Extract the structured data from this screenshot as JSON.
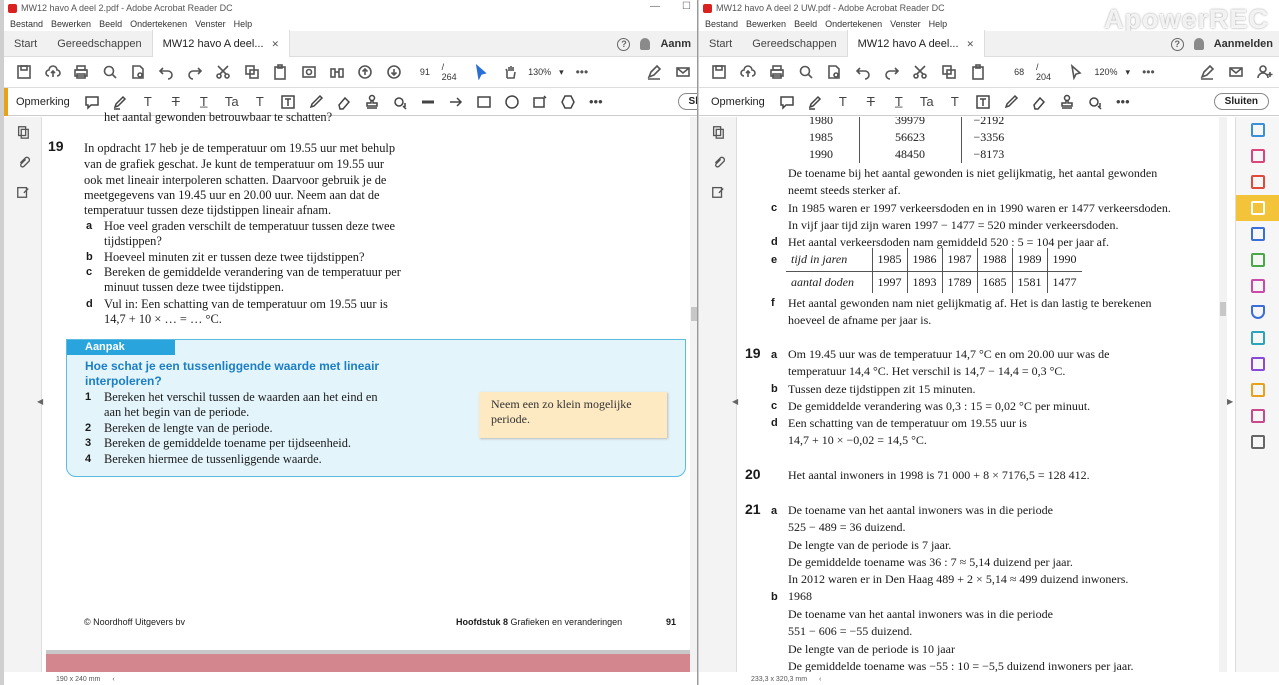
{
  "watermark": "ApowerREC",
  "left": {
    "title": "MW12 havo A deel 2.pdf - Adobe Acrobat Reader DC",
    "menu": [
      "Bestand",
      "Bewerken",
      "Beeld",
      "Ondertekenen",
      "Venster",
      "Help"
    ],
    "tabs": {
      "start": "Start",
      "tools": "Gereedschappen",
      "doc": "MW12 havo A deel...",
      "account": "Aanm"
    },
    "page_num": "91",
    "page_total": "/ 264",
    "zoom": "130%",
    "annot_label": "Opmerking",
    "sluiten_partial": "Sl",
    "status": "190 x 240 mm",
    "content": {
      "cut_line": "het aantal gewonden betrouwbaar te schatten?",
      "q19_num": "19",
      "q19_lines": [
        "In opdracht 17 heb je de temperatuur om 19.55 uur met behulp",
        "van de grafiek geschat. Je kunt de temperatuur om 19.55 uur",
        "ook met lineair interpoleren schatten. Daarvoor gebruik je de",
        "meetgegevens van 19.45 uur en 20.00 uur. Neem aan dat de",
        "temperatuur tussen deze tijdstippen lineair afnam."
      ],
      "sub": [
        {
          "letter": "a",
          "lines": [
            "Hoe veel graden verschilt de temperatuur tussen deze twee",
            "tijdstippen?"
          ]
        },
        {
          "letter": "b",
          "lines": [
            "Hoeveel minuten zit er tussen deze twee tijdstippen?"
          ]
        },
        {
          "letter": "c",
          "lines": [
            "Bereken de gemiddelde verandering van de temperatuur per",
            "minuut tussen deze twee tijdstippen."
          ]
        },
        {
          "letter": "d",
          "lines": [
            "Vul in: Een schatting van de temperatuur om 19.55 uur is",
            "14,7 + 10 × … = … °C."
          ]
        }
      ],
      "aanpak_label": "Aanpak",
      "aanpak_q": [
        "Hoe schat je een tussenliggende waarde met lineair",
        "interpoleren?"
      ],
      "aanpak_steps": [
        {
          "n": "1",
          "lines": [
            "Bereken het verschil tussen de waarden aan het eind en",
            "aan het begin van de periode."
          ]
        },
        {
          "n": "2",
          "lines": [
            "Bereken de lengte van de periode."
          ]
        },
        {
          "n": "3",
          "lines": [
            "Bereken de gemiddelde toename per tijdseenheid."
          ]
        },
        {
          "n": "4",
          "lines": [
            "Bereken hiermee de tussenliggende waarde."
          ]
        }
      ],
      "note": [
        "Neem een zo klein mogelijke",
        "periode."
      ],
      "footer_left": "© Noordhoff Uitgevers bv",
      "footer_chapter_bold": "Hoofdstuk 8",
      "footer_chapter": "Grafieken en veranderingen",
      "footer_page": "91"
    }
  },
  "right": {
    "title": "MW12 havo A deel 2 UW.pdf - Adobe Acrobat Reader DC",
    "menu": [
      "Bestand",
      "Bewerken",
      "Beeld",
      "Ondertekenen",
      "Venster",
      "Help"
    ],
    "tabs": {
      "start": "Start",
      "tools": "Gereedschappen",
      "doc": "MW12 havo A deel...",
      "account": "Aanmelden"
    },
    "page_num": "68",
    "page_total": "/ 204",
    "zoom": "120%",
    "annot_label": "Opmerking",
    "sluiten": "Sluiten",
    "status": "233,3 x 320,3 mm",
    "content": {
      "top_rows": [
        {
          "year": "1980",
          "val": "39979",
          "diff": "−2192"
        },
        {
          "year": "1985",
          "val": "56623",
          "diff": "−3356"
        },
        {
          "year": "1990",
          "val": "48450",
          "diff": "−8173"
        }
      ],
      "b_tail": [
        "De toename bij het aantal gewonden is niet gelijkmatig, het aantal gewonden",
        "neemt steeds sterker af."
      ],
      "c": {
        "letter": "c",
        "lines": [
          "In 1985 waren er 1997 verkeersdoden en in 1990 waren er 1477 verkeersdoden.",
          "In vijf jaar tijd zijn waren 1997 − 1477 = 520 minder verkeersdoden."
        ]
      },
      "d": {
        "letter": "d",
        "lines": [
          "Het aantal verkeersdoden nam gemiddeld 520 : 5 = 104 per jaar af."
        ]
      },
      "e": {
        "letter": "e",
        "row1": [
          "tijd in jaren",
          "1985",
          "1986",
          "1987",
          "1988",
          "1989",
          "1990"
        ],
        "row2": [
          "aantal doden",
          "1997",
          "1893",
          "1789",
          "1685",
          "1581",
          "1477"
        ]
      },
      "f": {
        "letter": "f",
        "lines": [
          "Het aantal gewonden nam niet gelijkmatig af. Het is dan lastig te berekenen",
          "hoeveel de afname per jaar is."
        ]
      },
      "q19": {
        "num": "19",
        "items": [
          {
            "letter": "a",
            "lines": [
              "Om 19.45 uur was de temperatuur 14,7 °C en om 20.00 uur was de",
              "temperatuur 14,4 °C. Het verschil is 14,7 − 14,4 = 0,3 °C."
            ]
          },
          {
            "letter": "b",
            "lines": [
              "Tussen deze tijdstippen zit 15 minuten."
            ]
          },
          {
            "letter": "c",
            "lines": [
              "De gemiddelde verandering was 0,3 : 15 = 0,02 °C per minuut."
            ]
          },
          {
            "letter": "d",
            "lines": [
              "Een schatting van de temperatuur om 19.55 uur is",
              "14,7 + 10 × −0,02 = 14,5 °C."
            ]
          }
        ]
      },
      "q20": {
        "num": "20",
        "line": "Het aantal inwoners in 1998 is 71 000 + 8 × 7176,5 = 128 412."
      },
      "q21": {
        "num": "21",
        "a_letter": "a",
        "a_lines": [
          "De toename van het aantal inwoners was in die periode",
          "525 − 489 = 36 duizend.",
          "De lengte van de periode is 7 jaar.",
          "De gemiddelde toename was 36 : 7 ≈ 5,14 duizend per jaar.",
          "In 2012 waren er in Den Haag 489 + 2 × 5,14 ≈ 499 duizend inwoners."
        ],
        "b_letter": "b",
        "b_lines": [
          "1968",
          "De toename van het aantal inwoners was in die periode",
          "551 − 606 = −55 duizend.",
          "De lengte van de periode is 10 jaar",
          "De gemiddelde toename was −55 : 10 = −5,5 duizend inwoners per jaar."
        ]
      }
    }
  },
  "colors": {
    "accent_orange": "#e8a11c",
    "aanpak_blue": "#2aa4dc",
    "note_yellow": "#fde9c2",
    "footer_pink": "#d4868e"
  }
}
